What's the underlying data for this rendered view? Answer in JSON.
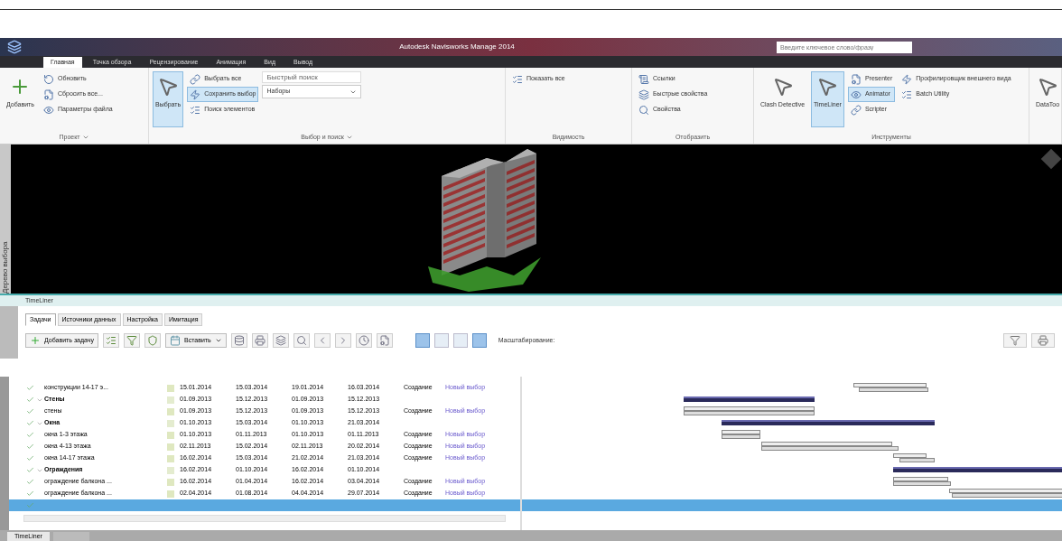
{
  "title_bar": {
    "title": "Autodesk Navisworks Manage 2014",
    "search_placeholder": "Введите ключевое слово/фразу"
  },
  "ribbon_tabs": [
    {
      "label": "Главная",
      "selected": true
    },
    {
      "label": "Точка обзора",
      "selected": false
    },
    {
      "label": "Рецензирование",
      "selected": false
    },
    {
      "label": "Анимация",
      "selected": false
    },
    {
      "label": "Вид",
      "selected": false
    },
    {
      "label": "Вывод",
      "selected": false
    }
  ],
  "ribbon_groups": [
    {
      "title": "Проект",
      "menu": true,
      "items": [
        {
          "kind": "large",
          "label": "Добавить",
          "selected": false
        },
        {
          "kind": "small",
          "label": "Обновить",
          "selected": false
        },
        {
          "kind": "small",
          "label": "Сбросить все...",
          "selected": false
        },
        {
          "kind": "small",
          "label": "Параметры файла",
          "selected": false
        }
      ]
    },
    {
      "title": "Выбор и поиск",
      "menu": true,
      "items": [
        {
          "kind": "large",
          "label": "Выбрать",
          "selected": true
        },
        {
          "kind": "small",
          "label": "Выбрать все",
          "selected": false
        },
        {
          "kind": "small",
          "label": "Сохранить выбор",
          "selected": true
        },
        {
          "kind": "small",
          "label": "Поиск элементов",
          "selected": false
        },
        {
          "kind": "field",
          "label": "Наборы",
          "placeholder": "Быстрый поиск"
        }
      ]
    },
    {
      "title": "Видимость",
      "items": [
        {
          "kind": "small",
          "label": "Показать все",
          "selected": false
        }
      ]
    },
    {
      "title": "Отобразить",
      "items": [
        {
          "kind": "small",
          "label": "Ссылки",
          "selected": false
        },
        {
          "kind": "small",
          "label": "Быстрые свойства",
          "selected": false
        },
        {
          "kind": "small",
          "label": "Свойства",
          "selected": false
        }
      ]
    },
    {
      "title": "Инструменты",
      "items": [
        {
          "kind": "large",
          "label": "Clash Detective",
          "selected": false
        },
        {
          "kind": "large",
          "label": "TimeLiner",
          "selected": true
        },
        {
          "kind": "small",
          "label": "Presenter",
          "selected": false
        },
        {
          "kind": "small",
          "label": "Animator",
          "selected": true
        },
        {
          "kind": "small",
          "label": "Scripter",
          "selected": false
        },
        {
          "kind": "small",
          "label": "Профилировщик внешнего вида",
          "selected": false
        },
        {
          "kind": "small",
          "label": "Batch Utility",
          "selected": false
        }
      ]
    },
    {
      "items": [
        {
          "kind": "large",
          "label": "DataToo",
          "selected": false
        }
      ]
    }
  ],
  "side_tab": "Дерево выбора",
  "timeliner": {
    "title": "TimeLiner",
    "tabs": [
      {
        "label": "Задачи",
        "selected": true
      },
      {
        "label": "Источники данных",
        "selected": false
      },
      {
        "label": "Настройка",
        "selected": false
      },
      {
        "label": "Имитация",
        "selected": false
      }
    ],
    "add_task": "Добавить задачу",
    "insert": "Вставить",
    "view_buttons": [
      {
        "selected": true
      },
      {
        "selected": false
      },
      {
        "selected": false
      },
      {
        "selected": true
      }
    ],
    "zoom_label": "Масштабирование:",
    "rows": [
      {
        "kind": "task",
        "name": "конструкции 14-17 э...",
        "checked": true,
        "selected": false,
        "planned_start": "15.01.2014",
        "planned_end": "15.03.2014",
        "actual_start": "19.01.2014",
        "actual_end": "16.03.2014",
        "task_type": "Создание",
        "appearance": "Новый выбор"
      },
      {
        "kind": "group",
        "name": "Стены",
        "expanded": true,
        "checked": true,
        "selected": false,
        "planned_start": "01.09.2013",
        "planned_end": "15.12.2013",
        "actual_start": "01.09.2013",
        "actual_end": "15.12.2013"
      },
      {
        "kind": "task",
        "name": "стены",
        "checked": true,
        "selected": false,
        "planned_start": "01.09.2013",
        "planned_end": "15.12.2013",
        "actual_start": "01.09.2013",
        "actual_end": "15.12.2013",
        "task_type": "Создание",
        "appearance": "Новый выбор"
      },
      {
        "kind": "group",
        "name": "Окна",
        "expanded": true,
        "checked": true,
        "selected": false,
        "planned_start": "01.10.2013",
        "planned_end": "15.03.2014",
        "actual_start": "01.10.2013",
        "actual_end": "21.03.2014"
      },
      {
        "kind": "task",
        "name": "окна 1-3 этажа",
        "checked": true,
        "selected": false,
        "planned_start": "01.10.2013",
        "planned_end": "01.11.2013",
        "actual_start": "01.10.2013",
        "actual_end": "01.11.2013",
        "task_type": "Создание",
        "appearance": "Новый выбор"
      },
      {
        "kind": "task",
        "name": "окна 4-13 этажа",
        "checked": true,
        "selected": false,
        "planned_start": "02.11.2013",
        "planned_end": "15.02.2014",
        "actual_start": "02.11.2013",
        "actual_end": "20.02.2014",
        "task_type": "Создание",
        "appearance": "Новый выбор"
      },
      {
        "kind": "task",
        "name": "окна 14-17 этажа",
        "checked": true,
        "selected": false,
        "planned_start": "16.02.2014",
        "planned_end": "15.03.2014",
        "actual_start": "21.02.2014",
        "actual_end": "21.03.2014",
        "task_type": "Создание",
        "appearance": "Новый выбор"
      },
      {
        "kind": "group",
        "name": "Ограждения",
        "expanded": true,
        "checked": true,
        "selected": false,
        "planned_start": "16.02.2014",
        "planned_end": "01.10.2014",
        "actual_start": "16.02.2014",
        "actual_end": "01.10.2014"
      },
      {
        "kind": "task",
        "name": "ограждение балкона ...",
        "checked": true,
        "selected": false,
        "planned_start": "16.02.2014",
        "planned_end": "01.04.2014",
        "actual_start": "16.02.2014",
        "actual_end": "03.04.2014",
        "task_type": "Создание",
        "appearance": "Новый выбор"
      },
      {
        "kind": "task",
        "name": "ограждение балкона ...",
        "checked": true,
        "selected": false,
        "planned_start": "02.04.2014",
        "planned_end": "01.08.2014",
        "actual_start": "04.04.2014",
        "actual_end": "29.07.2014",
        "task_type": "Создание",
        "appearance": "Новый выбор"
      },
      {
        "kind": "task",
        "checked": true,
        "selected": true
      }
    ]
  },
  "bottom_tabs": [
    {
      "label": "TimeLiner",
      "selected": true
    }
  ]
}
